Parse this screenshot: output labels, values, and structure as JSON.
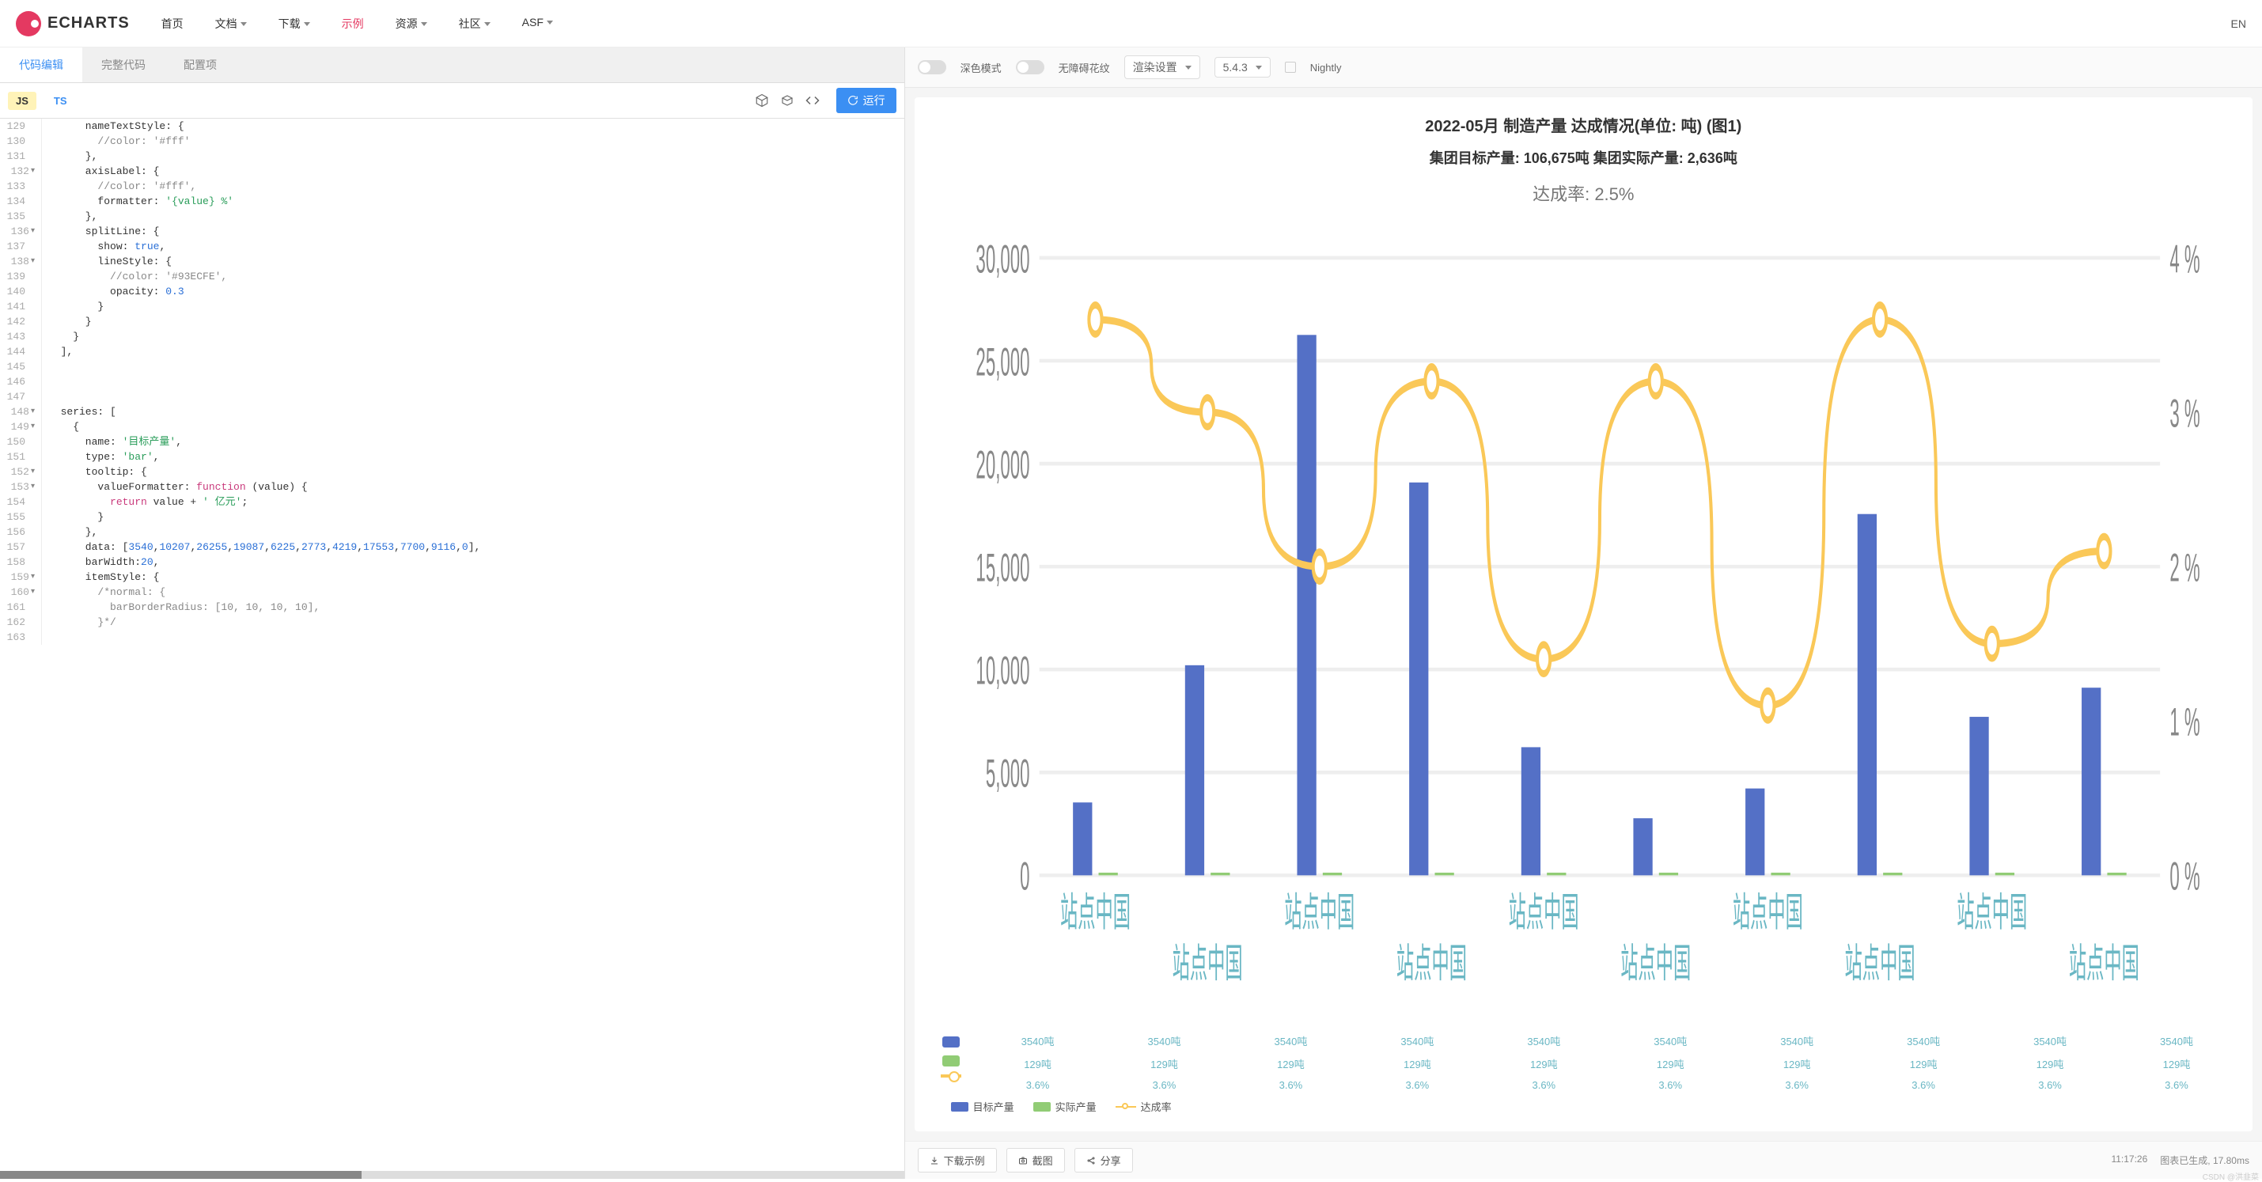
{
  "brand": "ECHARTS",
  "nav": {
    "items": [
      "首页",
      "文档",
      "下载",
      "示例",
      "资源",
      "社区",
      "ASF"
    ],
    "active_index": 3,
    "dropdown_indices": [
      1,
      2,
      4,
      5,
      6
    ],
    "lang": "EN"
  },
  "left_tabs": {
    "items": [
      "代码编辑",
      "完整代码",
      "配置项"
    ],
    "active_index": 0
  },
  "editor_bar": {
    "lang_js": "JS",
    "lang_ts": "TS",
    "run": "运行",
    "icons": [
      "cube-icon",
      "box-icon",
      "code-icon"
    ]
  },
  "editor": {
    "start_line": 129,
    "lines": [
      {
        "n": 129,
        "fold": "",
        "t": "      nameTextStyle: {"
      },
      {
        "n": 130,
        "fold": "",
        "t": "        //color: '#fff'",
        "cls": "tok-com"
      },
      {
        "n": 131,
        "fold": "",
        "t": "      },"
      },
      {
        "n": 132,
        "fold": "▾",
        "t": "      axisLabel: {"
      },
      {
        "n": 133,
        "fold": "",
        "t": "        //color: '#fff',",
        "cls": "tok-com"
      },
      {
        "n": 134,
        "fold": "",
        "t": "        formatter: '{value} %'",
        "seg": [
          [
            "        formatter: ",
            ""
          ],
          [
            "'{value} %'",
            "tok-str"
          ]
        ]
      },
      {
        "n": 135,
        "fold": "",
        "t": "      },"
      },
      {
        "n": 136,
        "fold": "▾",
        "t": "      splitLine: {"
      },
      {
        "n": 137,
        "fold": "",
        "t": "        show: true,",
        "seg": [
          [
            "        show: ",
            ""
          ],
          [
            "true",
            "tok-bool"
          ],
          [
            ",",
            ""
          ]
        ]
      },
      {
        "n": 138,
        "fold": "▾",
        "t": "        lineStyle: {"
      },
      {
        "n": 139,
        "fold": "",
        "t": "          //color: '#93ECFE',",
        "cls": "tok-com"
      },
      {
        "n": 140,
        "fold": "",
        "t": "          opacity: 0.3",
        "seg": [
          [
            "          opacity: ",
            ""
          ],
          [
            "0.3",
            "tok-num"
          ]
        ]
      },
      {
        "n": 141,
        "fold": "",
        "t": "        }"
      },
      {
        "n": 142,
        "fold": "",
        "t": "      }"
      },
      {
        "n": 143,
        "fold": "",
        "t": "    }"
      },
      {
        "n": 144,
        "fold": "",
        "t": "  ],"
      },
      {
        "n": 145,
        "fold": "",
        "t": ""
      },
      {
        "n": 146,
        "fold": "",
        "t": ""
      },
      {
        "n": 147,
        "fold": "",
        "t": ""
      },
      {
        "n": 148,
        "fold": "▾",
        "t": "  series: ["
      },
      {
        "n": 149,
        "fold": "▾",
        "t": "    {"
      },
      {
        "n": 150,
        "fold": "",
        "t": "      name: '目标产量',",
        "seg": [
          [
            "      name: ",
            ""
          ],
          [
            "'目标产量'",
            "tok-str"
          ],
          [
            ",",
            ""
          ]
        ]
      },
      {
        "n": 151,
        "fold": "",
        "t": "      type: 'bar',",
        "seg": [
          [
            "      type: ",
            ""
          ],
          [
            "'bar'",
            "tok-str"
          ],
          [
            ",",
            ""
          ]
        ]
      },
      {
        "n": 152,
        "fold": "▾",
        "t": "      tooltip: {"
      },
      {
        "n": 153,
        "fold": "▾",
        "t": "        valueFormatter: function (value) {",
        "seg": [
          [
            "        valueFormatter: ",
            ""
          ],
          [
            "function",
            "tok-kw"
          ],
          [
            " (value) {",
            ""
          ]
        ]
      },
      {
        "n": 154,
        "fold": "",
        "t": "          return value + ' 亿元';",
        "seg": [
          [
            "          ",
            ""
          ],
          [
            "return",
            "tok-kw"
          ],
          [
            " value + ",
            ""
          ],
          [
            "' 亿元'",
            "tok-str"
          ],
          [
            ";",
            ""
          ]
        ]
      },
      {
        "n": 155,
        "fold": "",
        "t": "        }"
      },
      {
        "n": 156,
        "fold": "",
        "t": "      },"
      },
      {
        "n": 157,
        "fold": "",
        "t": "      data: [3540,10207,26255,19087,6225,2773,4219,17553,7700,9116,0],",
        "seg": [
          [
            "      data: [",
            ""
          ],
          [
            "3540",
            "tok-num"
          ],
          [
            ",",
            ""
          ],
          [
            "10207",
            "tok-num"
          ],
          [
            ",",
            ""
          ],
          [
            "26255",
            "tok-num"
          ],
          [
            ",",
            ""
          ],
          [
            "19087",
            "tok-num"
          ],
          [
            ",",
            ""
          ],
          [
            "6225",
            "tok-num"
          ],
          [
            ",",
            ""
          ],
          [
            "2773",
            "tok-num"
          ],
          [
            ",",
            ""
          ],
          [
            "4219",
            "tok-num"
          ],
          [
            ",",
            ""
          ],
          [
            "17553",
            "tok-num"
          ],
          [
            ",",
            ""
          ],
          [
            "7700",
            "tok-num"
          ],
          [
            ",",
            ""
          ],
          [
            "9116",
            "tok-num"
          ],
          [
            ",",
            ""
          ],
          [
            "0",
            "tok-num"
          ],
          [
            "],",
            ""
          ]
        ]
      },
      {
        "n": 158,
        "fold": "",
        "t": "      barWidth:20,",
        "seg": [
          [
            "      barWidth:",
            ""
          ],
          [
            "20",
            "tok-num"
          ],
          [
            ",",
            ""
          ]
        ]
      },
      {
        "n": 159,
        "fold": "▾",
        "t": "      itemStyle: {"
      },
      {
        "n": 160,
        "fold": "▾",
        "t": "        /*normal: {",
        "cls": "tok-com"
      },
      {
        "n": 161,
        "fold": "",
        "t": "          barBorderRadius: [10, 10, 10, 10],",
        "cls": "tok-com"
      },
      {
        "n": 162,
        "fold": "",
        "t": "        }*/",
        "cls": "tok-com"
      },
      {
        "n": 163,
        "fold": "",
        "t": ""
      }
    ]
  },
  "right_bar": {
    "dark_mode": "深色模式",
    "a11y_pattern": "无障碍花纹",
    "render_settings": "渲染设置",
    "version": "5.4.3",
    "nightly": "Nightly"
  },
  "chart_header": {
    "title": "2022-05月 制造产量 达成情况(单位: 吨) (图1)",
    "subtitle": "集团目标产量: 106,675吨    集团实际产量: 2,636吨",
    "rate": "达成率: 2.5%"
  },
  "chart_data": {
    "type": "bar",
    "categories": [
      "站点中国",
      "站点中国",
      "站点中国",
      "站点中国",
      "站点中国",
      "站点中国",
      "站点中国",
      "站点中国",
      "站点中国",
      "站点中国"
    ],
    "y_left": {
      "label": "",
      "ticks": [
        0,
        5000,
        10000,
        15000,
        20000,
        25000,
        30000
      ],
      "ylim": [
        0,
        30000
      ]
    },
    "y_right": {
      "label": "",
      "ticks": [
        "0 %",
        "1 %",
        "2 %",
        "3 %",
        "4 %"
      ],
      "ylim": [
        0,
        4
      ]
    },
    "series": [
      {
        "name": "目标产量",
        "type": "bar",
        "color": "#5470c6",
        "values": [
          3540,
          10207,
          26255,
          19087,
          6225,
          2773,
          4219,
          17553,
          7700,
          9116
        ]
      },
      {
        "name": "实际产量",
        "type": "bar",
        "color": "#91cc75",
        "values": [
          129,
          129,
          129,
          129,
          129,
          129,
          129,
          129,
          129,
          129
        ]
      },
      {
        "name": "达成率",
        "type": "line",
        "color": "#fac858",
        "axis": "right",
        "values": [
          3.6,
          3.0,
          2.0,
          3.2,
          1.4,
          3.2,
          1.1,
          3.6,
          1.5,
          2.1
        ]
      }
    ],
    "legend_table": {
      "rows": [
        {
          "icon": "bar1",
          "cells": [
            "3540吨",
            "3540吨",
            "3540吨",
            "3540吨",
            "3540吨",
            "3540吨",
            "3540吨",
            "3540吨",
            "3540吨",
            "3540吨"
          ]
        },
        {
          "icon": "bar2",
          "cells": [
            "129吨",
            "129吨",
            "129吨",
            "129吨",
            "129吨",
            "129吨",
            "129吨",
            "129吨",
            "129吨",
            "129吨"
          ]
        },
        {
          "icon": "line",
          "cells": [
            "3.6%",
            "3.6%",
            "3.6%",
            "3.6%",
            "3.6%",
            "3.6%",
            "3.6%",
            "3.6%",
            "3.6%",
            "3.6%"
          ]
        }
      ]
    }
  },
  "series_legend": [
    "目标产量",
    "实际产量",
    "达成率"
  ],
  "bottom": {
    "download": "下载示例",
    "screenshot": "截图",
    "share": "分享",
    "time": "11:17:26",
    "status": "图表已生成, 17.80ms",
    "watermark": "CSDN @洪韭菜"
  }
}
